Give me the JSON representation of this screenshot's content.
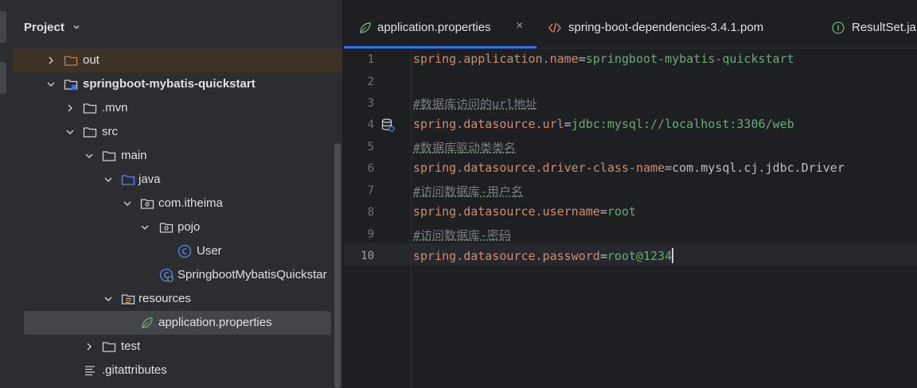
{
  "project_panel": {
    "title": "Project",
    "tree": [
      {
        "label": "out",
        "type": "folder-excluded",
        "level": 1,
        "expanded": false
      },
      {
        "label": "springboot-mybatis-quickstart",
        "type": "module",
        "level": 1,
        "expanded": true
      },
      {
        "label": ".mvn",
        "type": "folder",
        "level": 2,
        "expanded": false
      },
      {
        "label": "src",
        "type": "folder",
        "level": 2,
        "expanded": true
      },
      {
        "label": "main",
        "type": "folder",
        "level": 3,
        "expanded": true
      },
      {
        "label": "java",
        "type": "source-folder",
        "level": 4,
        "expanded": true
      },
      {
        "label": "com.itheima",
        "type": "package",
        "level": 5,
        "expanded": true
      },
      {
        "label": "pojo",
        "type": "package",
        "level": 6,
        "expanded": true
      },
      {
        "label": "User",
        "type": "class",
        "level": 7
      },
      {
        "label": "SpringbootMybatisQuickstar",
        "type": "spring-boot-class",
        "level": 6
      },
      {
        "label": "resources",
        "type": "resources-folder",
        "level": 4,
        "expanded": true
      },
      {
        "label": "application.properties",
        "type": "properties-file",
        "level": 5,
        "selected": true
      },
      {
        "label": "test",
        "type": "folder",
        "level": 3,
        "expanded": false
      },
      {
        "label": ".gitattributes",
        "type": "text-file",
        "level": 2
      }
    ]
  },
  "tabs": [
    {
      "label": "application.properties",
      "icon": "spring-leaf-icon",
      "active": true,
      "close": "×"
    },
    {
      "label": "spring-boot-dependencies-3.4.1.pom",
      "icon": "xml-tag-icon",
      "active": false
    },
    {
      "label": "ResultSet.ja",
      "icon": "info-circle-icon",
      "active": false
    }
  ],
  "editor": {
    "current_line": 10,
    "lines": [
      {
        "n": "1",
        "key": "spring.application.name",
        "eq": "=",
        "value": "springboot-mybatis-quickstart"
      },
      {
        "n": "2"
      },
      {
        "n": "3",
        "comment": "#数据库访问的url地址"
      },
      {
        "n": "4",
        "key": "spring.datasource.url",
        "eq": "=",
        "value": "jdbc:mysql://localhost:3306/web",
        "gutter_icon": "database-icon"
      },
      {
        "n": "5",
        "comment": "#数据库驱动类类名"
      },
      {
        "n": "6",
        "key": "spring.datasource.driver-class-name",
        "eq": "=",
        "value": "com.mysql.cj.jdbc.Driver"
      },
      {
        "n": "7",
        "comment": "#访问数据库-用户名"
      },
      {
        "n": "8",
        "key": "spring.datasource.username",
        "eq": "=",
        "value": "root"
      },
      {
        "n": "9",
        "comment": "#访问数据库-密码"
      },
      {
        "n": "10",
        "key": "spring.datasource.password",
        "eq": "=",
        "value": "root@1234"
      }
    ]
  },
  "colors": {
    "key": "#cf8e6d",
    "value_green": "#6aab73",
    "comment": "#7a7e85",
    "accent": "#3574f0",
    "background": "#1e1f22",
    "panel": "#2b2d30"
  }
}
